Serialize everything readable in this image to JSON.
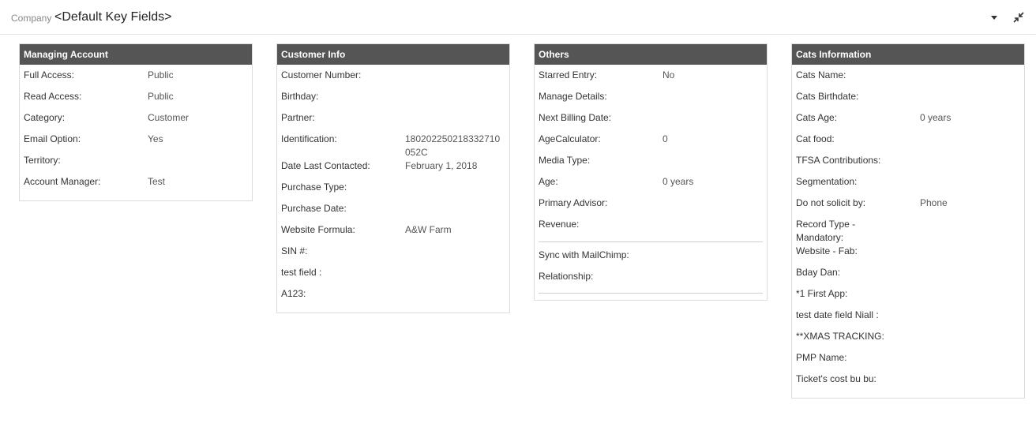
{
  "header": {
    "breadcrumb": "Company",
    "title": "<Default Key Fields>",
    "dropdown_icon": "caret-down-icon",
    "collapse_icon": "collapse-arrows-icon"
  },
  "panels": {
    "managing": {
      "title": "Managing Account",
      "rows": [
        {
          "label": "Full Access:",
          "value": "Public"
        },
        {
          "label": "Read Access:",
          "value": "Public"
        },
        {
          "label": "Category:",
          "value": "Customer"
        },
        {
          "label": "Email Option:",
          "value": "Yes"
        },
        {
          "label": "Territory:",
          "value": ""
        },
        {
          "label": "Account Manager:",
          "value": "Test"
        }
      ]
    },
    "customer": {
      "title": "Customer Info",
      "rows": [
        {
          "label": "Customer Number:",
          "value": ""
        },
        {
          "label": "Birthday:",
          "value": ""
        },
        {
          "label": "Partner:",
          "value": ""
        },
        {
          "label": "Identification:",
          "value": "180202250218332710052C"
        },
        {
          "label": "Date Last Contacted:",
          "value": "February 1, 2018"
        },
        {
          "label": "Purchase Type:",
          "value": ""
        },
        {
          "label": "Purchase Date:",
          "value": ""
        },
        {
          "label": "Website Formula:",
          "value": "A&W Farm"
        },
        {
          "label": "SIN #:",
          "value": ""
        },
        {
          "label": "test field :",
          "value": ""
        },
        {
          "label": "A123:",
          "value": ""
        }
      ]
    },
    "others": {
      "title": "Others",
      "rows": [
        {
          "label": "Starred Entry:",
          "value": "No"
        },
        {
          "label": "Manage Details:",
          "value": ""
        },
        {
          "label": "Next Billing Date:",
          "value": ""
        },
        {
          "label": "AgeCalculator:",
          "value": "0"
        },
        {
          "label": "Media Type:",
          "value": ""
        },
        {
          "label": "Age:",
          "value": "0 years"
        },
        {
          "label": "Primary Advisor:",
          "value": ""
        },
        {
          "label": "Revenue:",
          "value": ""
        }
      ],
      "rows2": [
        {
          "label": "Sync with MailChimp:",
          "value": ""
        },
        {
          "label": "Relationship:",
          "value": ""
        }
      ]
    },
    "cats": {
      "title": "Cats Information",
      "rows": [
        {
          "label": "Cats Name:",
          "value": ""
        },
        {
          "label": "Cats Birthdate:",
          "value": ""
        },
        {
          "label": "Cats Age:",
          "value": "0 years"
        },
        {
          "label": "Cat food:",
          "value": ""
        },
        {
          "label": "TFSA Contributions:",
          "value": ""
        },
        {
          "label": "Segmentation:",
          "value": ""
        },
        {
          "label": "Do not solicit by:",
          "value": "Phone"
        },
        {
          "label": "Record Type - Mandatory:",
          "value": ""
        },
        {
          "label": "Website - Fab:",
          "value": ""
        },
        {
          "label": "Bday Dan:",
          "value": ""
        },
        {
          "label": "*1 First App:",
          "value": ""
        },
        {
          "label": "test date field Niall :",
          "value": ""
        },
        {
          "label": "**XMAS TRACKING:",
          "value": ""
        },
        {
          "label": "PMP Name:",
          "value": ""
        },
        {
          "label": "Ticket's cost bu bu:",
          "value": ""
        }
      ]
    }
  }
}
